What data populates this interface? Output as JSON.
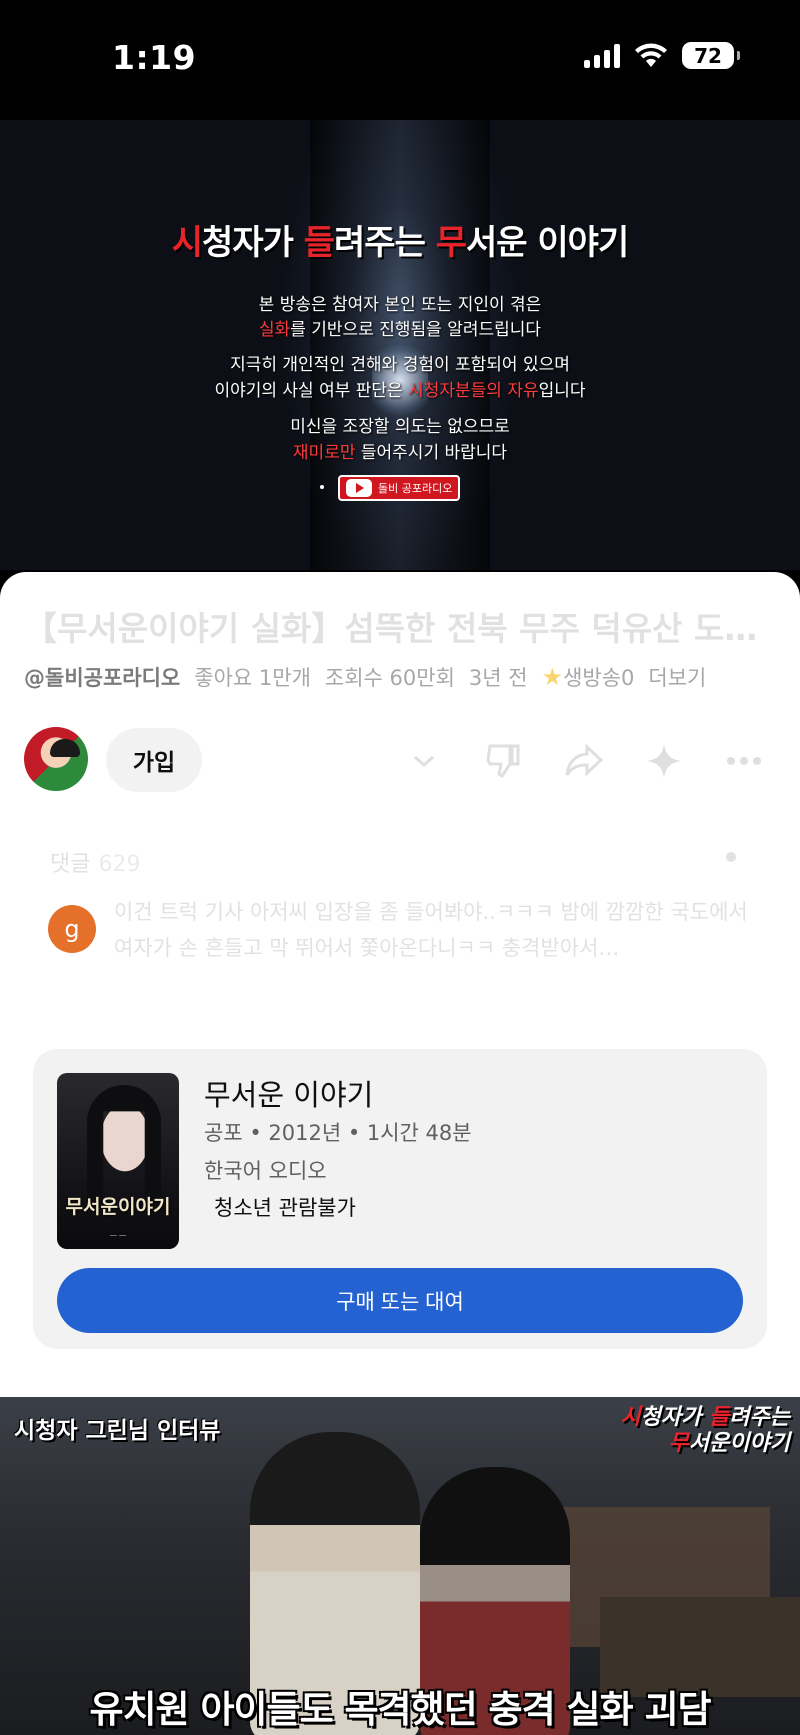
{
  "status_bar": {
    "time": "1:19",
    "battery": "72"
  },
  "video_player": {
    "title_parts": [
      "시",
      "청자가 ",
      "들",
      "려주는 ",
      "무",
      "서운 이야기"
    ],
    "line1": "본 방송은 참여자 본인 또는 지인이 겪은",
    "line2_highlight": "실화",
    "line2_rest": "를 기반으로 진행됨을 알려드립니다",
    "line3": "지극히 개인적인 견해와 경험이 포함되어 있으며",
    "line4_start": "이야기의 사실 여부 판단은 ",
    "line4_highlight": "시청자분들의 자유",
    "line4_end": "입니다",
    "line5": "미신을 조장할 의도는 없으므로",
    "line6_highlight": "재미로만",
    "line6_rest": " 들어주시기 바랍니다",
    "badge_text": "돌비 공포라디오"
  },
  "video_info": {
    "title": "【무서운이야기 실화】섬뜩한 전북 무주 덕유산 도로…",
    "channel": "@돌비공포라디오",
    "likes": "좋아요 1만개",
    "views": "조회수 60만회",
    "age": "3년 전",
    "tag": "생방송0",
    "more": "더보기"
  },
  "channel_row": {
    "join_label": "가입"
  },
  "comments": {
    "label": "댓글",
    "count": "629",
    "avatar_letter": "g",
    "text": "이건 트럭 기사 아저씨 입장을 좀 들어봐야..ㅋㅋㅋ 밤에 깜깜한 국도에서 여자가 손 흔들고 막 뛰어서 쫓아온다니ㅋㅋ 충격받아서…"
  },
  "movie_card": {
    "poster_title": "무서운이야기",
    "title": "무서운 이야기",
    "meta": "공포 • 2012년 • 1시간 48분",
    "audio": "한국어 오디오",
    "rating": "청소년 관람불가",
    "button": "구매 또는 대여"
  },
  "thumbnail": {
    "label_left": "시청자 그린님 인터뷰",
    "label_right_parts": [
      "시",
      "청자가 ",
      "들",
      "려주는",
      "무",
      "서운이야기"
    ],
    "caption": "유치원 아이들도 목격했던 충격 실화 괴담"
  },
  "colors": {
    "accent_red": "#e8232a",
    "button_blue": "#2462d2",
    "card_bg": "#f2f2f2"
  }
}
